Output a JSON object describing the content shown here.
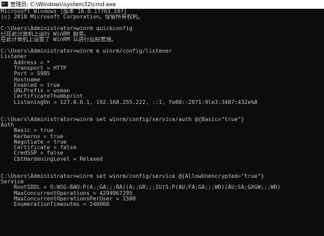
{
  "window": {
    "title": "管理员: C:\\Windows\\system32\\cmd.exe"
  },
  "console": {
    "lines": [
      "Microsoft Windows [版本 10.0.17763.107]",
      "(c) 2018 Microsoft Corporation。保留所有权利。",
      "",
      "C:\\Users\\Administrator>winrm quickconfig",
      "已在此计算机上运行 WinRM 服务。",
      "在此计算机上设置了 WinRM 以进行远程管理。",
      "",
      "C:\\Users\\Administrator>winrm e winrm/config/listener",
      "Listener",
      "    Address = *",
      "    Transport = HTTP",
      "    Port = 5985",
      "    Hostname",
      "    Enabled = true",
      "    URLPrefix = wsman",
      "    CertificateThumbprint",
      "    ListeningOn = 127.0.0.1, 192.168.255.222, ::1, fe80::2071:9le3:3487:432e%8",
      "",
      "",
      "C:\\Users\\Administrator>winrm set winrm/config/service/auth @{Basic=\"true\"}",
      "Auth",
      "    Basic = true",
      "    Kerberos = true",
      "    Negotiate = true",
      "    Certificate = false",
      "    CredSSP = false",
      "    CbtHardeningLevel = Relaxed",
      "",
      "",
      "C:\\Users\\Administrator>winrm set winrm/config/service @{AllowUnencrypted=\"true\"}",
      "Service",
      "    RootSDDL = O:NSG:BAD:P(A;;GA;;;BA)(A;;GR;;;IU)S:P(AU;FA;GA;;;WD)(AU;SA;GXGW;;;WD)",
      "    MaxConcurrentOperations = 4294967295",
      "    MaxConcurrentOperationsPerUser = 1500",
      "    EnumerationTimeoutms = 240000"
    ]
  }
}
